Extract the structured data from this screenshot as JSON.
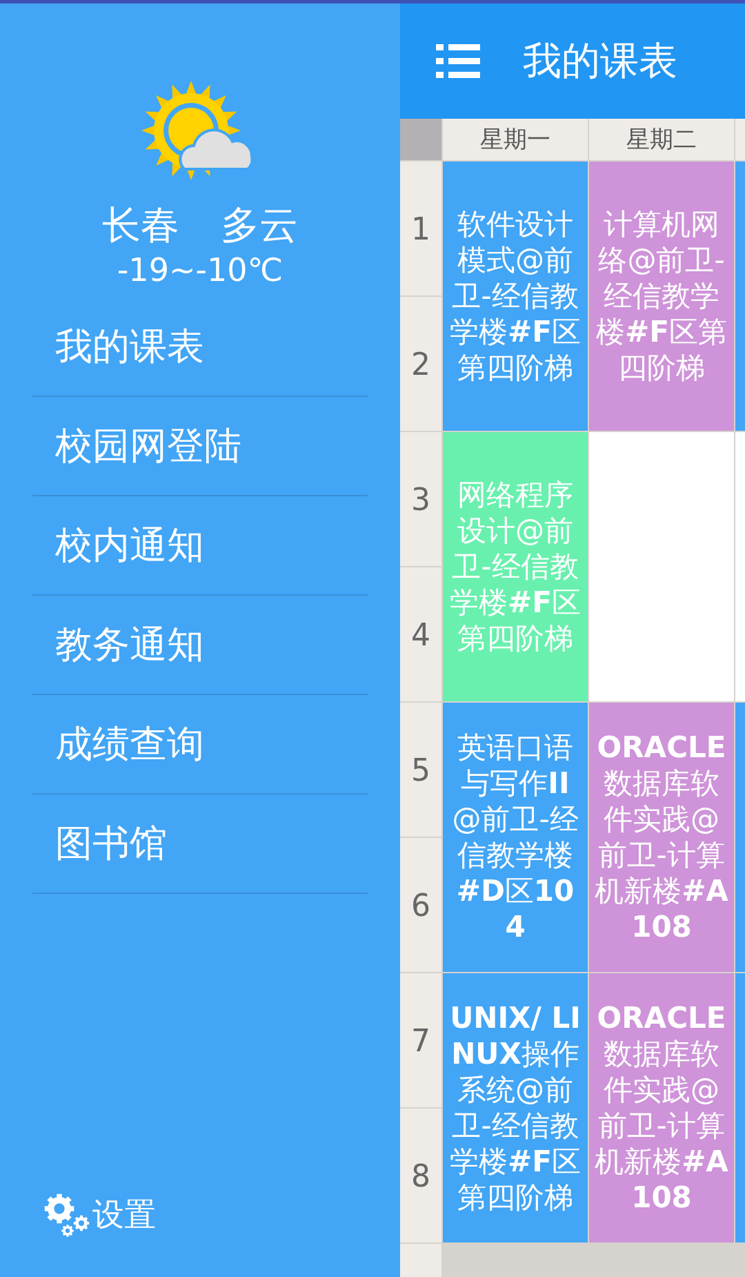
{
  "drawer": {
    "weather": {
      "city": "长春",
      "condition": "多云",
      "temperature": "-19~-10℃"
    },
    "menu": [
      {
        "label": "我的课表"
      },
      {
        "label": "校园网登陆"
      },
      {
        "label": "校内通知"
      },
      {
        "label": "教务通知"
      },
      {
        "label": "成绩查询"
      },
      {
        "label": "图书馆"
      }
    ],
    "settings": {
      "label": "设置"
    }
  },
  "app_bar": {
    "title": "我的课表"
  },
  "timetable": {
    "periods": [
      "1",
      "2",
      "3",
      "4",
      "5",
      "6",
      "7",
      "8"
    ],
    "columns": [
      {
        "label": "星期一",
        "slots": [
          {
            "kind": "course",
            "text": "软件设计模式@前卫-经信教学楼**#F**区第四阶梯",
            "color": "#42a5f5"
          },
          {
            "kind": "course",
            "text": "网络程序设计@前卫-经信教学楼**#F**区第四阶梯",
            "color": "#69f0ae"
          },
          {
            "kind": "course",
            "text": "英语口语与写作**II**@前卫-经信教学楼**#D**区**104**",
            "color": "#42a5f5"
          },
          {
            "kind": "course",
            "text": "**UNIX/ LINUX**操作系统@前卫-经信教学楼**#F**区第四阶梯",
            "color": "#42a5f5"
          }
        ]
      },
      {
        "label": "星期二",
        "slots": [
          {
            "kind": "course",
            "text": "计算机网络@前卫-经信教学楼**#F**区第四阶梯",
            "color": "#ce93d8"
          },
          {
            "kind": "empty"
          },
          {
            "kind": "course",
            "text": "**ORACLE**数据库软件实践@前卫-计算机新楼**#A108**",
            "color": "#ce93d8"
          },
          {
            "kind": "course",
            "text": "**ORACLE**数据库软件实践@前卫-计算机新楼**#A108**",
            "color": "#ce93d8"
          }
        ]
      },
      {
        "slots": [
          {
            "kind": "course",
            "color": "#42a5f5"
          },
          {
            "kind": "empty"
          },
          {
            "kind": "course",
            "color": "#42a5f5"
          },
          {
            "kind": "course",
            "color": "#42a5f5"
          }
        ]
      }
    ]
  }
}
